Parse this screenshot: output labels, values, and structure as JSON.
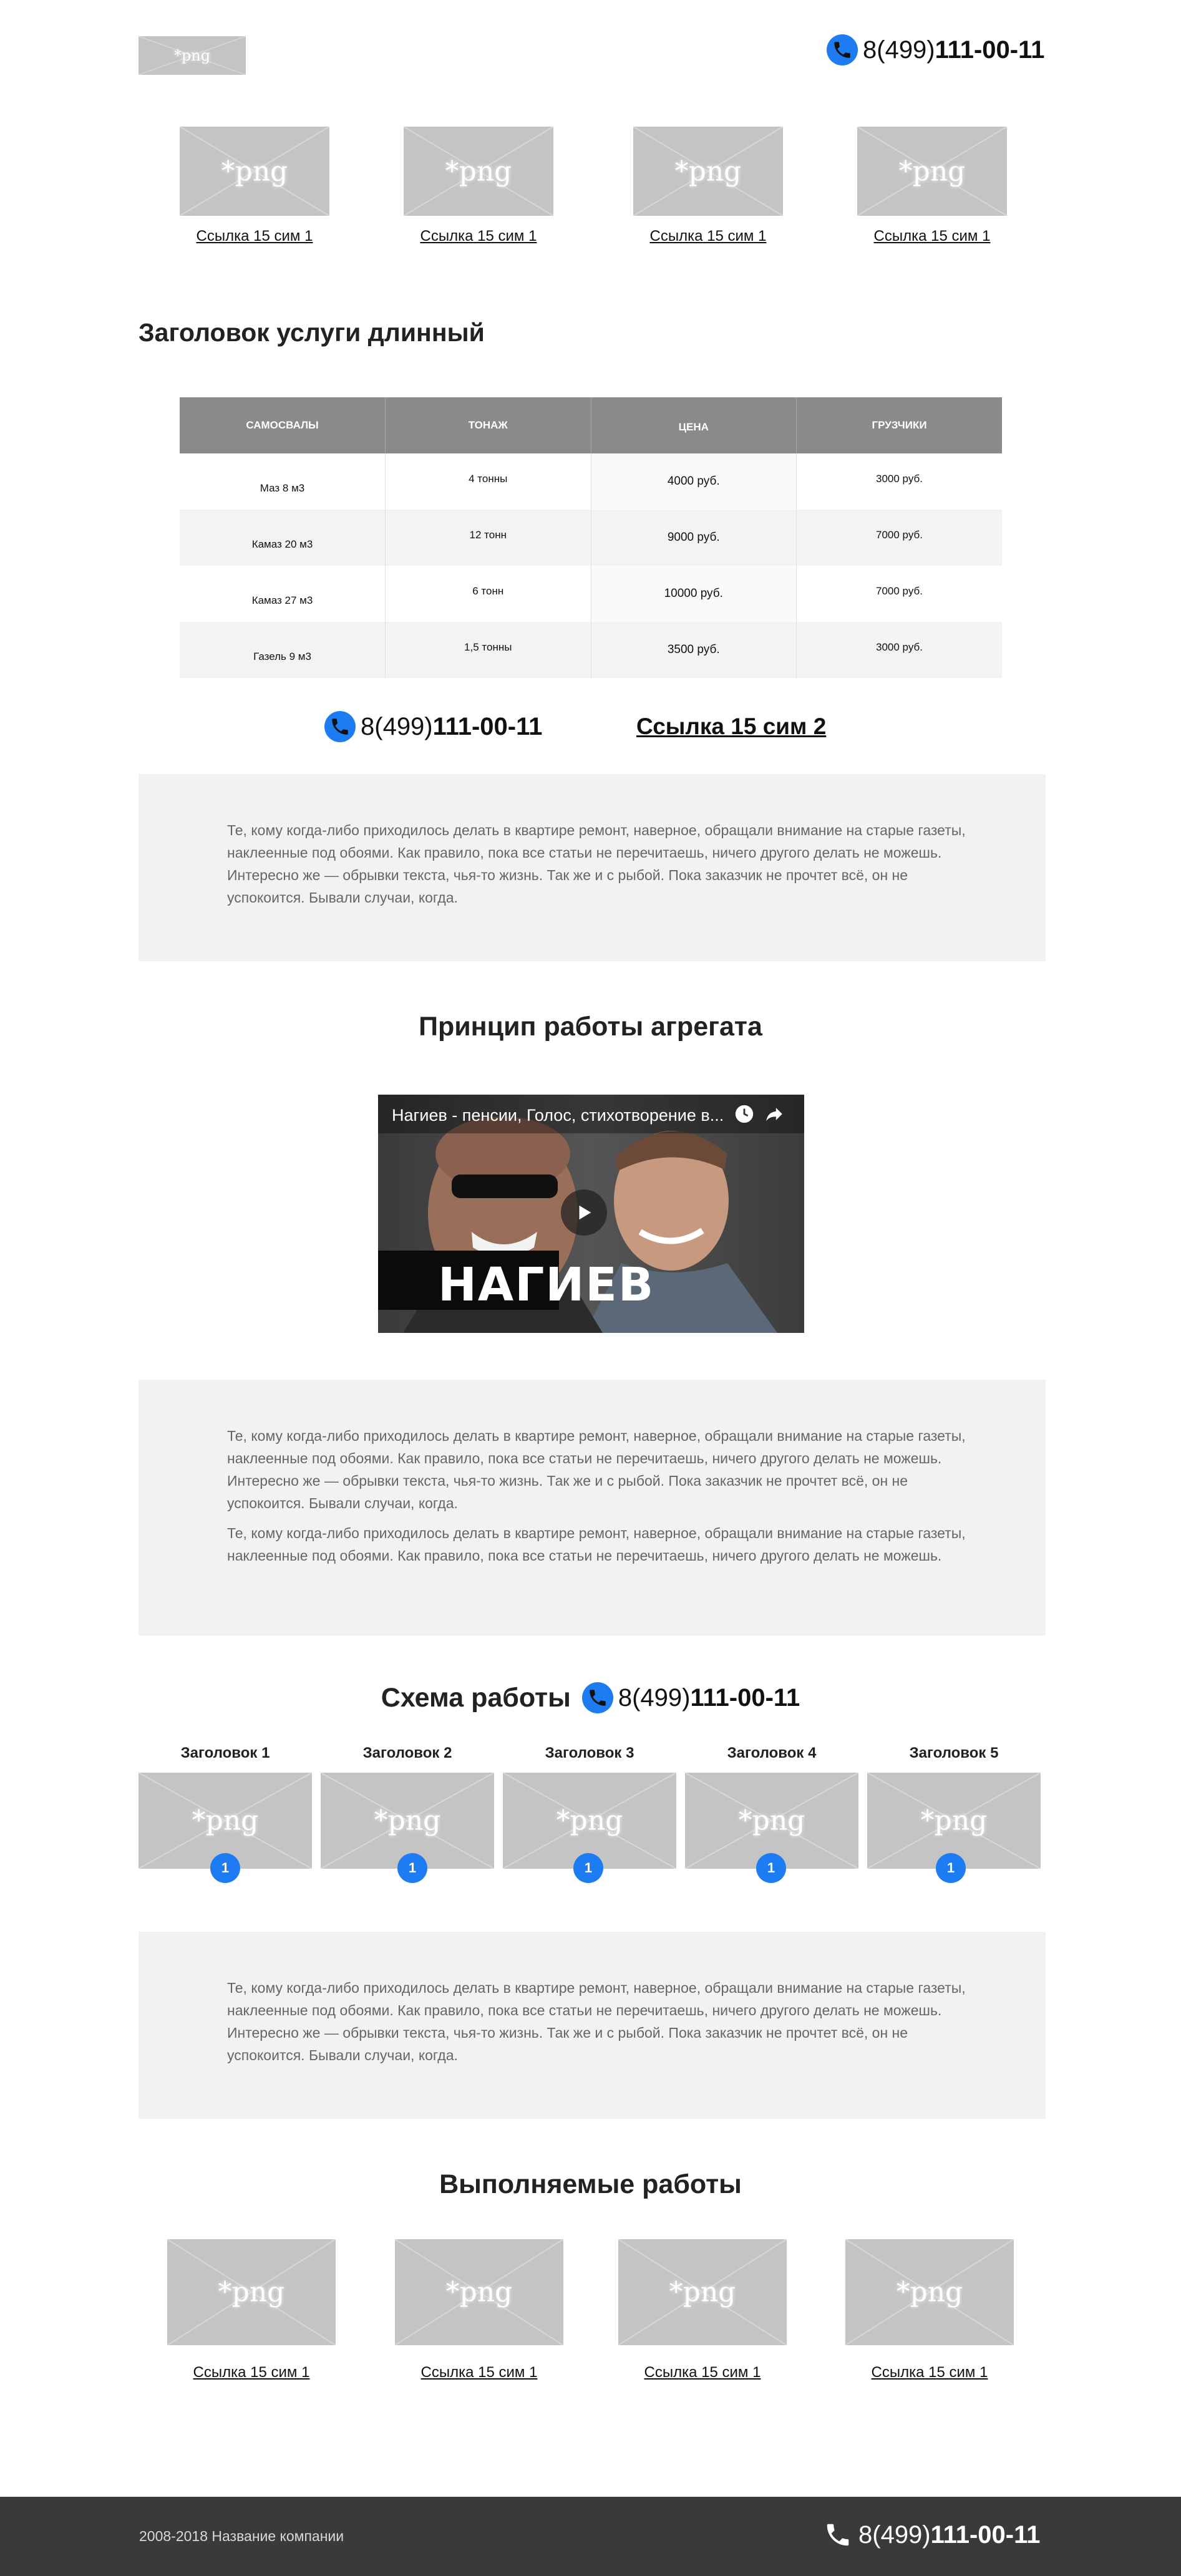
{
  "header": {
    "logo_label": "*png",
    "phone": {
      "prefix": "8(499)",
      "number": "111-00-11"
    }
  },
  "top_gallery": {
    "items": [
      {
        "image_label": "*png",
        "link": "Ссылка 15 сим 1"
      },
      {
        "image_label": "*png",
        "link": "Ссылка 15 сим 1"
      },
      {
        "image_label": "*png",
        "link": "Ссылка 15 сим 1"
      },
      {
        "image_label": "*png",
        "link": "Ссылка 15 сим 1"
      }
    ]
  },
  "service": {
    "title": "Заголовок услуги длинный",
    "table": {
      "headers": [
        "САМОСВАЛЫ",
        "ТОНАЖ",
        "ЦЕНА",
        "ГРУЗЧИКИ"
      ],
      "rows": [
        [
          "Маз 8 м3",
          "4 тонны",
          "4000 руб.",
          "3000 руб."
        ],
        [
          "Камаз 20 м3",
          "12 тонн",
          "9000 руб.",
          "7000 руб."
        ],
        [
          "Камаз 27 м3",
          "6 тонн",
          "10000 руб.",
          "7000 руб."
        ],
        [
          "Газель 9 м3",
          "1,5 тонны",
          "3500 руб.",
          "3000 руб."
        ]
      ]
    },
    "phone": {
      "prefix": "8(499)",
      "number": "111-00-11"
    },
    "link": "Ссылка 15 сим 2"
  },
  "text_block_1": {
    "paragraph": "Те, кому когда-либо приходилось делать в квартире ремонт, наверное, обращали внимание на старые газеты, наклеенные под обоями. Как правило, пока все статьи не перечитаешь, ничего другого делать не можешь. Интересно же — обрывки текста, чья-то жизнь. Так же и с рыбой. Пока заказчик не прочтет всё, он не успокоится. Бывали случаи, когда."
  },
  "principle": {
    "title": "Принцип работы агрегата",
    "video": {
      "title": "Нагиев - пенсии, Голос, стихотворение в...",
      "overlay_text": "НАГИЕВ"
    }
  },
  "text_block_2": {
    "paragraph_1": "Те, кому когда-либо приходилось делать в квартире ремонт, наверное, обращали внимание на старые газеты, наклеенные под обоями. Как правило, пока все статьи не перечитаешь, ничего другого делать не можешь. Интересно же — обрывки текста, чья-то жизнь. Так же и с рыбой. Пока заказчик не прочтет всё, он не успокоится. Бывали случаи, когда.",
    "paragraph_2": "Те, кому когда-либо приходилось делать в квартире ремонт, наверное, обращали внимание на старые газеты, наклеенные под обоями. Как правило, пока все статьи не перечитаешь, ничего другого делать не можешь."
  },
  "scheme": {
    "title": "Схема работы",
    "phone": {
      "prefix": "8(499)",
      "number": "111-00-11"
    },
    "steps": [
      {
        "heading": "Заголовок 1",
        "image_label": "*png",
        "badge": "1"
      },
      {
        "heading": "Заголовок 2",
        "image_label": "*png",
        "badge": "1"
      },
      {
        "heading": "Заголовок 3",
        "image_label": "*png",
        "badge": "1"
      },
      {
        "heading": "Заголовок 4",
        "image_label": "*png",
        "badge": "1"
      },
      {
        "heading": "Заголовок 5",
        "image_label": "*png",
        "badge": "1"
      }
    ]
  },
  "text_block_3": {
    "paragraph": "Те, кому когда-либо приходилось делать в квартире ремонт, наверное, обращали внимание на старые газеты, наклеенные под обоями. Как правило, пока все статьи не перечитаешь, ничего другого делать не можешь. Интересно же — обрывки текста, чья-то жизнь. Так же и с рыбой. Пока заказчик не прочтет всё, он не успокоится. Бывали случаи, когда."
  },
  "works": {
    "title": "Выполняемые работы",
    "items": [
      {
        "image_label": "*png",
        "link": "Ссылка 15 сим 1"
      },
      {
        "image_label": "*png",
        "link": "Ссылка 15 сим 1"
      },
      {
        "image_label": "*png",
        "link": "Ссылка 15 сим 1"
      },
      {
        "image_label": "*png",
        "link": "Ссылка 15 сим 1"
      }
    ]
  },
  "footer": {
    "copyright": "2008-2018 Название компании",
    "phone": {
      "prefix": "8(499)",
      "number": "111-00-11"
    }
  },
  "colors": {
    "accent": "#1e7cf2",
    "placeholder": "#c4c4c4",
    "table_header": "#8a8a8a",
    "text_box": "#f2f2f2",
    "footer": "#3a3a3a"
  }
}
